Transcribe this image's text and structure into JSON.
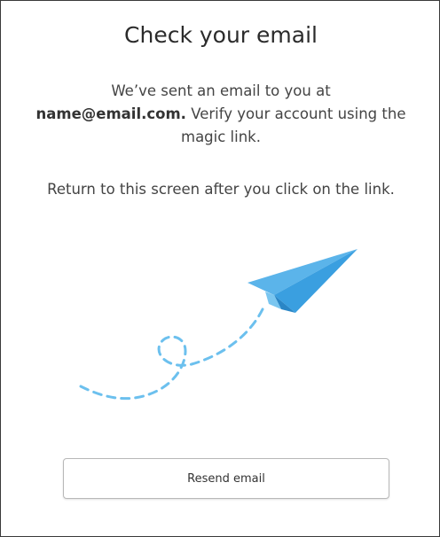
{
  "page": {
    "title": "Check your email"
  },
  "message": {
    "line_intro": "We’ve sent an email to you at",
    "email": "name@email.com.",
    "line_rest": " Verify your account using the magic link.",
    "return_text": "Return to this screen after you click on the link."
  },
  "illustration": {
    "icon": "paper-plane-icon",
    "plane_color": "#5bb4ea",
    "plane_dark_color": "#3a9fe0",
    "trail_color": "#6cc0ee"
  },
  "actions": {
    "resend_label": "Resend email"
  }
}
